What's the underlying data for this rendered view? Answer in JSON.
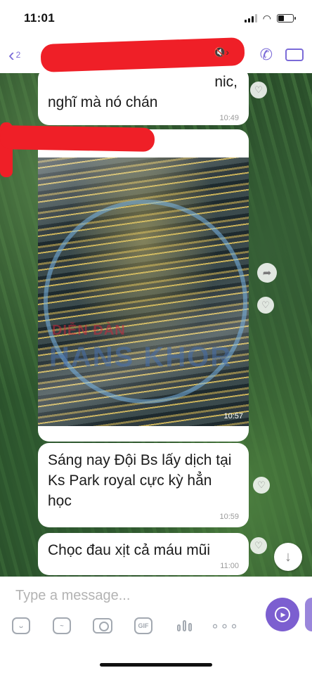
{
  "status_bar": {
    "time": "11:01"
  },
  "header": {
    "back_count": "2",
    "mute_glyph": "🔇›"
  },
  "messages": [
    {
      "id": "top",
      "partial_word": "nic,",
      "text": "nghĩ mà nó chán",
      "time": "10:49"
    },
    {
      "id": "image",
      "watermark_line1": "DIỄN ĐÀN",
      "watermark_line2": "HANS KHOR",
      "time": "10:57"
    },
    {
      "id": "m3",
      "text": "Sáng nay Đội Bs lấy dịch tại Ks Park royal cực kỳ hẳn học",
      "time": "10:59"
    },
    {
      "id": "m4",
      "text": "Chọc đau xịt cả máu mũi",
      "time": "11:00"
    }
  ],
  "composer": {
    "placeholder": "Type a message..."
  },
  "toolbar": {
    "gif_label": "GIF"
  },
  "colors": {
    "accent": "#7c5fd0",
    "redaction": "#ef1f27"
  }
}
